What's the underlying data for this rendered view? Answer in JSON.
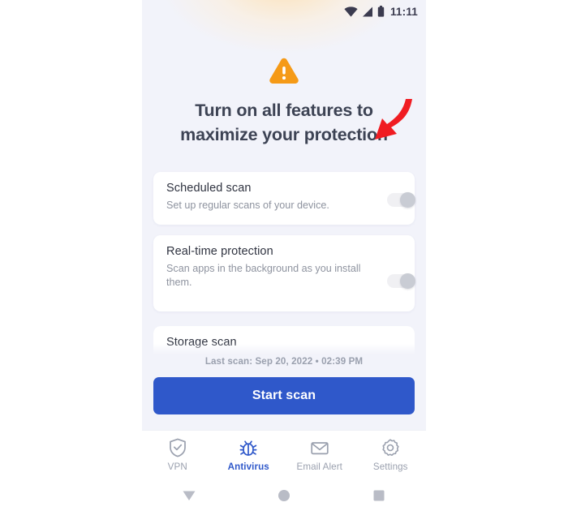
{
  "status_bar": {
    "time": "11:11",
    "icons": [
      "wifi-icon",
      "cellular-signal-icon",
      "battery-icon"
    ]
  },
  "colors": {
    "screen_background": "#f2f3fa",
    "card_background": "#ffffff",
    "primary_blue": "#2f58ca",
    "warning_orange": "#f59a17",
    "annotation_red": "#f01c22",
    "title_text": "#3d4354",
    "muted_text": "#9aa0ae",
    "toggle_track": "#f0f0f3",
    "toggle_knob": "#c9ccd4"
  },
  "hero": {
    "icon": "warning-triangle-icon",
    "headline_line1": "Turn on all features to",
    "headline_line2": "maximize your protection"
  },
  "features": [
    {
      "id": "scheduled-scan",
      "title": "Scheduled scan",
      "subtitle": "Set up regular scans of your device.",
      "toggle_state": "off"
    },
    {
      "id": "real-time-protection",
      "title": "Real-time protection",
      "subtitle": "Scan apps in the background as you install them.",
      "toggle_state": "off"
    },
    {
      "id": "storage-scan",
      "title": "Storage scan",
      "subtitle": "",
      "toggle_state": "off"
    }
  ],
  "annotation": {
    "shape": "curved-arrow-down-left",
    "points_to": "real-time-protection-toggle",
    "color": "#f01c22"
  },
  "last_scan": {
    "text": "Last scan: Sep 20, 2022 • 02:39 PM"
  },
  "primary_action": {
    "label": "Start scan"
  },
  "tab_bar": {
    "items": [
      {
        "id": "vpn",
        "label": "VPN",
        "icon": "shield-check-icon",
        "active": false
      },
      {
        "id": "antivirus",
        "label": "Antivirus",
        "icon": "bug-icon",
        "active": true
      },
      {
        "id": "email-alert",
        "label": "Email Alert",
        "icon": "envelope-icon",
        "active": false
      },
      {
        "id": "settings",
        "label": "Settings",
        "icon": "gear-icon",
        "active": false
      }
    ]
  },
  "system_nav": {
    "items": [
      {
        "id": "back",
        "icon": "triangle-down-icon"
      },
      {
        "id": "home",
        "icon": "circle-icon"
      },
      {
        "id": "recents",
        "icon": "square-icon"
      }
    ]
  }
}
